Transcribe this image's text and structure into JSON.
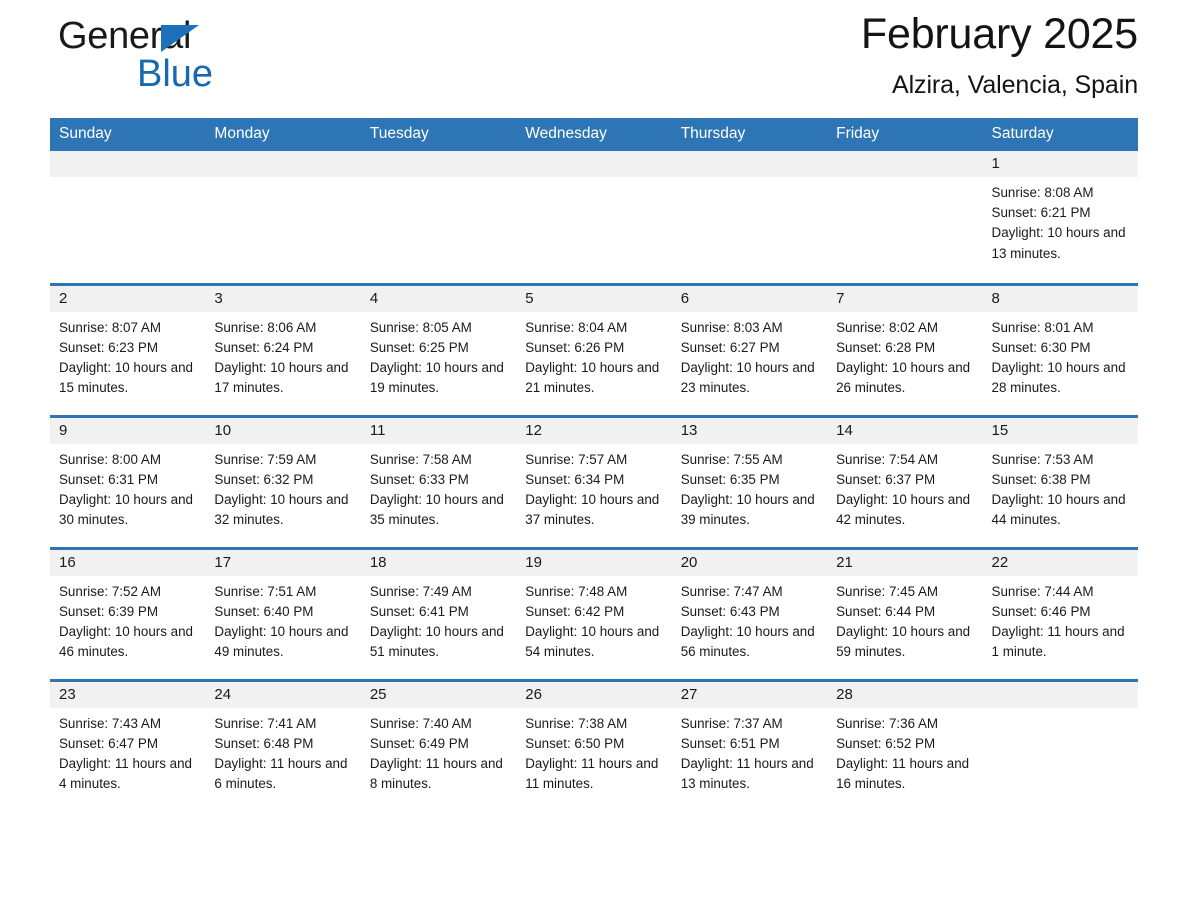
{
  "logo": {
    "word_one": "General",
    "word_two": "Blue",
    "triangle_color": "#1c71b8"
  },
  "header": {
    "title": "February 2025",
    "location": "Alzira, Valencia, Spain"
  },
  "theme": {
    "header_blue": "#2e75b6",
    "date_band_gray": "#f1f1f1",
    "text": "#1a1a1a"
  },
  "calendar": {
    "day_headers": [
      "Sunday",
      "Monday",
      "Tuesday",
      "Wednesday",
      "Thursday",
      "Friday",
      "Saturday"
    ],
    "weeks": [
      [
        {
          "date": "",
          "sunrise": "",
          "sunset": "",
          "daylight": ""
        },
        {
          "date": "",
          "sunrise": "",
          "sunset": "",
          "daylight": ""
        },
        {
          "date": "",
          "sunrise": "",
          "sunset": "",
          "daylight": ""
        },
        {
          "date": "",
          "sunrise": "",
          "sunset": "",
          "daylight": ""
        },
        {
          "date": "",
          "sunrise": "",
          "sunset": "",
          "daylight": ""
        },
        {
          "date": "",
          "sunrise": "",
          "sunset": "",
          "daylight": ""
        },
        {
          "date": "1",
          "sunrise": "Sunrise: 8:08 AM",
          "sunset": "Sunset: 6:21 PM",
          "daylight": "Daylight: 10 hours and 13 minutes."
        }
      ],
      [
        {
          "date": "2",
          "sunrise": "Sunrise: 8:07 AM",
          "sunset": "Sunset: 6:23 PM",
          "daylight": "Daylight: 10 hours and 15 minutes."
        },
        {
          "date": "3",
          "sunrise": "Sunrise: 8:06 AM",
          "sunset": "Sunset: 6:24 PM",
          "daylight": "Daylight: 10 hours and 17 minutes."
        },
        {
          "date": "4",
          "sunrise": "Sunrise: 8:05 AM",
          "sunset": "Sunset: 6:25 PM",
          "daylight": "Daylight: 10 hours and 19 minutes."
        },
        {
          "date": "5",
          "sunrise": "Sunrise: 8:04 AM",
          "sunset": "Sunset: 6:26 PM",
          "daylight": "Daylight: 10 hours and 21 minutes."
        },
        {
          "date": "6",
          "sunrise": "Sunrise: 8:03 AM",
          "sunset": "Sunset: 6:27 PM",
          "daylight": "Daylight: 10 hours and 23 minutes."
        },
        {
          "date": "7",
          "sunrise": "Sunrise: 8:02 AM",
          "sunset": "Sunset: 6:28 PM",
          "daylight": "Daylight: 10 hours and 26 minutes."
        },
        {
          "date": "8",
          "sunrise": "Sunrise: 8:01 AM",
          "sunset": "Sunset: 6:30 PM",
          "daylight": "Daylight: 10 hours and 28 minutes."
        }
      ],
      [
        {
          "date": "9",
          "sunrise": "Sunrise: 8:00 AM",
          "sunset": "Sunset: 6:31 PM",
          "daylight": "Daylight: 10 hours and 30 minutes."
        },
        {
          "date": "10",
          "sunrise": "Sunrise: 7:59 AM",
          "sunset": "Sunset: 6:32 PM",
          "daylight": "Daylight: 10 hours and 32 minutes."
        },
        {
          "date": "11",
          "sunrise": "Sunrise: 7:58 AM",
          "sunset": "Sunset: 6:33 PM",
          "daylight": "Daylight: 10 hours and 35 minutes."
        },
        {
          "date": "12",
          "sunrise": "Sunrise: 7:57 AM",
          "sunset": "Sunset: 6:34 PM",
          "daylight": "Daylight: 10 hours and 37 minutes."
        },
        {
          "date": "13",
          "sunrise": "Sunrise: 7:55 AM",
          "sunset": "Sunset: 6:35 PM",
          "daylight": "Daylight: 10 hours and 39 minutes."
        },
        {
          "date": "14",
          "sunrise": "Sunrise: 7:54 AM",
          "sunset": "Sunset: 6:37 PM",
          "daylight": "Daylight: 10 hours and 42 minutes."
        },
        {
          "date": "15",
          "sunrise": "Sunrise: 7:53 AM",
          "sunset": "Sunset: 6:38 PM",
          "daylight": "Daylight: 10 hours and 44 minutes."
        }
      ],
      [
        {
          "date": "16",
          "sunrise": "Sunrise: 7:52 AM",
          "sunset": "Sunset: 6:39 PM",
          "daylight": "Daylight: 10 hours and 46 minutes."
        },
        {
          "date": "17",
          "sunrise": "Sunrise: 7:51 AM",
          "sunset": "Sunset: 6:40 PM",
          "daylight": "Daylight: 10 hours and 49 minutes."
        },
        {
          "date": "18",
          "sunrise": "Sunrise: 7:49 AM",
          "sunset": "Sunset: 6:41 PM",
          "daylight": "Daylight: 10 hours and 51 minutes."
        },
        {
          "date": "19",
          "sunrise": "Sunrise: 7:48 AM",
          "sunset": "Sunset: 6:42 PM",
          "daylight": "Daylight: 10 hours and 54 minutes."
        },
        {
          "date": "20",
          "sunrise": "Sunrise: 7:47 AM",
          "sunset": "Sunset: 6:43 PM",
          "daylight": "Daylight: 10 hours and 56 minutes."
        },
        {
          "date": "21",
          "sunrise": "Sunrise: 7:45 AM",
          "sunset": "Sunset: 6:44 PM",
          "daylight": "Daylight: 10 hours and 59 minutes."
        },
        {
          "date": "22",
          "sunrise": "Sunrise: 7:44 AM",
          "sunset": "Sunset: 6:46 PM",
          "daylight": "Daylight: 11 hours and 1 minute."
        }
      ],
      [
        {
          "date": "23",
          "sunrise": "Sunrise: 7:43 AM",
          "sunset": "Sunset: 6:47 PM",
          "daylight": "Daylight: 11 hours and 4 minutes."
        },
        {
          "date": "24",
          "sunrise": "Sunrise: 7:41 AM",
          "sunset": "Sunset: 6:48 PM",
          "daylight": "Daylight: 11 hours and 6 minutes."
        },
        {
          "date": "25",
          "sunrise": "Sunrise: 7:40 AM",
          "sunset": "Sunset: 6:49 PM",
          "daylight": "Daylight: 11 hours and 8 minutes."
        },
        {
          "date": "26",
          "sunrise": "Sunrise: 7:38 AM",
          "sunset": "Sunset: 6:50 PM",
          "daylight": "Daylight: 11 hours and 11 minutes."
        },
        {
          "date": "27",
          "sunrise": "Sunrise: 7:37 AM",
          "sunset": "Sunset: 6:51 PM",
          "daylight": "Daylight: 11 hours and 13 minutes."
        },
        {
          "date": "28",
          "sunrise": "Sunrise: 7:36 AM",
          "sunset": "Sunset: 6:52 PM",
          "daylight": "Daylight: 11 hours and 16 minutes."
        },
        {
          "date": "",
          "sunrise": "",
          "sunset": "",
          "daylight": ""
        }
      ]
    ]
  }
}
